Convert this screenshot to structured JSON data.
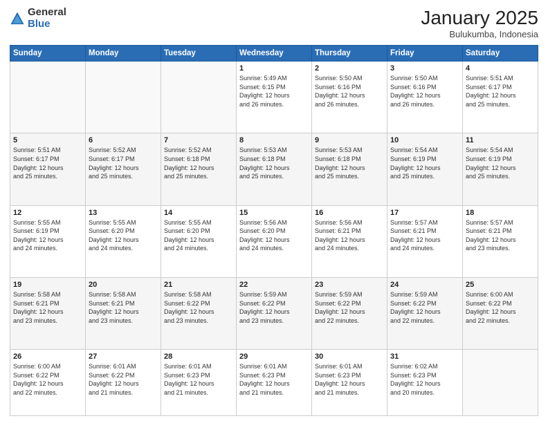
{
  "logo": {
    "general": "General",
    "blue": "Blue"
  },
  "header": {
    "month": "January 2025",
    "location": "Bulukumba, Indonesia"
  },
  "weekdays": [
    "Sunday",
    "Monday",
    "Tuesday",
    "Wednesday",
    "Thursday",
    "Friday",
    "Saturday"
  ],
  "weeks": [
    [
      {
        "day": "",
        "info": ""
      },
      {
        "day": "",
        "info": ""
      },
      {
        "day": "",
        "info": ""
      },
      {
        "day": "1",
        "info": "Sunrise: 5:49 AM\nSunset: 6:15 PM\nDaylight: 12 hours\nand 26 minutes."
      },
      {
        "day": "2",
        "info": "Sunrise: 5:50 AM\nSunset: 6:16 PM\nDaylight: 12 hours\nand 26 minutes."
      },
      {
        "day": "3",
        "info": "Sunrise: 5:50 AM\nSunset: 6:16 PM\nDaylight: 12 hours\nand 26 minutes."
      },
      {
        "day": "4",
        "info": "Sunrise: 5:51 AM\nSunset: 6:17 PM\nDaylight: 12 hours\nand 25 minutes."
      }
    ],
    [
      {
        "day": "5",
        "info": "Sunrise: 5:51 AM\nSunset: 6:17 PM\nDaylight: 12 hours\nand 25 minutes."
      },
      {
        "day": "6",
        "info": "Sunrise: 5:52 AM\nSunset: 6:17 PM\nDaylight: 12 hours\nand 25 minutes."
      },
      {
        "day": "7",
        "info": "Sunrise: 5:52 AM\nSunset: 6:18 PM\nDaylight: 12 hours\nand 25 minutes."
      },
      {
        "day": "8",
        "info": "Sunrise: 5:53 AM\nSunset: 6:18 PM\nDaylight: 12 hours\nand 25 minutes."
      },
      {
        "day": "9",
        "info": "Sunrise: 5:53 AM\nSunset: 6:18 PM\nDaylight: 12 hours\nand 25 minutes."
      },
      {
        "day": "10",
        "info": "Sunrise: 5:54 AM\nSunset: 6:19 PM\nDaylight: 12 hours\nand 25 minutes."
      },
      {
        "day": "11",
        "info": "Sunrise: 5:54 AM\nSunset: 6:19 PM\nDaylight: 12 hours\nand 25 minutes."
      }
    ],
    [
      {
        "day": "12",
        "info": "Sunrise: 5:55 AM\nSunset: 6:19 PM\nDaylight: 12 hours\nand 24 minutes."
      },
      {
        "day": "13",
        "info": "Sunrise: 5:55 AM\nSunset: 6:20 PM\nDaylight: 12 hours\nand 24 minutes."
      },
      {
        "day": "14",
        "info": "Sunrise: 5:55 AM\nSunset: 6:20 PM\nDaylight: 12 hours\nand 24 minutes."
      },
      {
        "day": "15",
        "info": "Sunrise: 5:56 AM\nSunset: 6:20 PM\nDaylight: 12 hours\nand 24 minutes."
      },
      {
        "day": "16",
        "info": "Sunrise: 5:56 AM\nSunset: 6:21 PM\nDaylight: 12 hours\nand 24 minutes."
      },
      {
        "day": "17",
        "info": "Sunrise: 5:57 AM\nSunset: 6:21 PM\nDaylight: 12 hours\nand 24 minutes."
      },
      {
        "day": "18",
        "info": "Sunrise: 5:57 AM\nSunset: 6:21 PM\nDaylight: 12 hours\nand 23 minutes."
      }
    ],
    [
      {
        "day": "19",
        "info": "Sunrise: 5:58 AM\nSunset: 6:21 PM\nDaylight: 12 hours\nand 23 minutes."
      },
      {
        "day": "20",
        "info": "Sunrise: 5:58 AM\nSunset: 6:21 PM\nDaylight: 12 hours\nand 23 minutes."
      },
      {
        "day": "21",
        "info": "Sunrise: 5:58 AM\nSunset: 6:22 PM\nDaylight: 12 hours\nand 23 minutes."
      },
      {
        "day": "22",
        "info": "Sunrise: 5:59 AM\nSunset: 6:22 PM\nDaylight: 12 hours\nand 23 minutes."
      },
      {
        "day": "23",
        "info": "Sunrise: 5:59 AM\nSunset: 6:22 PM\nDaylight: 12 hours\nand 22 minutes."
      },
      {
        "day": "24",
        "info": "Sunrise: 5:59 AM\nSunset: 6:22 PM\nDaylight: 12 hours\nand 22 minutes."
      },
      {
        "day": "25",
        "info": "Sunrise: 6:00 AM\nSunset: 6:22 PM\nDaylight: 12 hours\nand 22 minutes."
      }
    ],
    [
      {
        "day": "26",
        "info": "Sunrise: 6:00 AM\nSunset: 6:22 PM\nDaylight: 12 hours\nand 22 minutes."
      },
      {
        "day": "27",
        "info": "Sunrise: 6:01 AM\nSunset: 6:22 PM\nDaylight: 12 hours\nand 21 minutes."
      },
      {
        "day": "28",
        "info": "Sunrise: 6:01 AM\nSunset: 6:23 PM\nDaylight: 12 hours\nand 21 minutes."
      },
      {
        "day": "29",
        "info": "Sunrise: 6:01 AM\nSunset: 6:23 PM\nDaylight: 12 hours\nand 21 minutes."
      },
      {
        "day": "30",
        "info": "Sunrise: 6:01 AM\nSunset: 6:23 PM\nDaylight: 12 hours\nand 21 minutes."
      },
      {
        "day": "31",
        "info": "Sunrise: 6:02 AM\nSunset: 6:23 PM\nDaylight: 12 hours\nand 20 minutes."
      },
      {
        "day": "",
        "info": ""
      }
    ]
  ]
}
